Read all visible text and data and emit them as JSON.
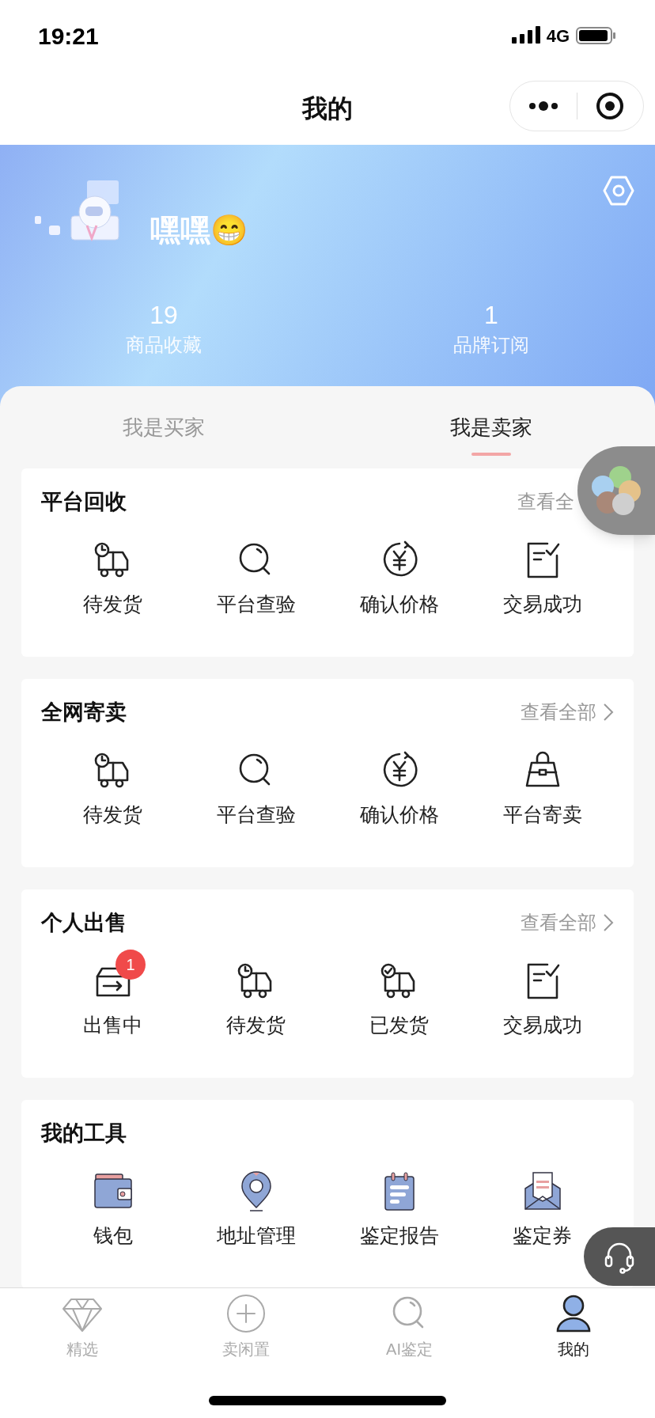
{
  "status_bar": {
    "time": "19:21",
    "network": "4G"
  },
  "title_bar": {
    "title": "我的"
  },
  "profile": {
    "name": "嘿嘿😁",
    "stats": [
      {
        "value": "19",
        "label": "商品收藏"
      },
      {
        "value": "1",
        "label": "品牌订阅"
      }
    ]
  },
  "tabs": [
    {
      "label": "我是买家",
      "selected": false
    },
    {
      "label": "我是卖家",
      "selected": true
    }
  ],
  "sections": [
    {
      "title": "平台回收",
      "link": "查看全",
      "arrow": false,
      "items": [
        {
          "label": "待发货",
          "kind": "truck-clock"
        },
        {
          "label": "平台查验",
          "kind": "search"
        },
        {
          "label": "确认价格",
          "kind": "yen"
        },
        {
          "label": "交易成功",
          "kind": "doc-check"
        }
      ]
    },
    {
      "title": "全网寄卖",
      "link": "查看全部",
      "arrow": true,
      "items": [
        {
          "label": "待发货",
          "kind": "truck-clock"
        },
        {
          "label": "平台查验",
          "kind": "search"
        },
        {
          "label": "确认价格",
          "kind": "yen"
        },
        {
          "label": "平台寄卖",
          "kind": "bag"
        }
      ]
    },
    {
      "title": "个人出售",
      "link": "查看全部",
      "arrow": true,
      "items": [
        {
          "label": "出售中",
          "kind": "tray-arrow",
          "badge": "1"
        },
        {
          "label": "待发货",
          "kind": "truck-clock"
        },
        {
          "label": "已发货",
          "kind": "truck-check"
        },
        {
          "label": "交易成功",
          "kind": "doc-check"
        }
      ]
    },
    {
      "title": "我的工具",
      "items": [
        {
          "label": "钱包",
          "kind": "wallet"
        },
        {
          "label": "地址管理",
          "kind": "pin"
        },
        {
          "label": "鉴定报告",
          "kind": "notepad"
        },
        {
          "label": "鉴定券",
          "kind": "envelope"
        }
      ]
    }
  ],
  "nav": [
    {
      "label": "精选",
      "kind": "diamond",
      "selected": false
    },
    {
      "label": "卖闲置",
      "kind": "plus",
      "selected": false
    },
    {
      "label": "AI鉴定",
      "kind": "search",
      "selected": false
    },
    {
      "label": "我的",
      "kind": "person",
      "selected": true
    }
  ]
}
